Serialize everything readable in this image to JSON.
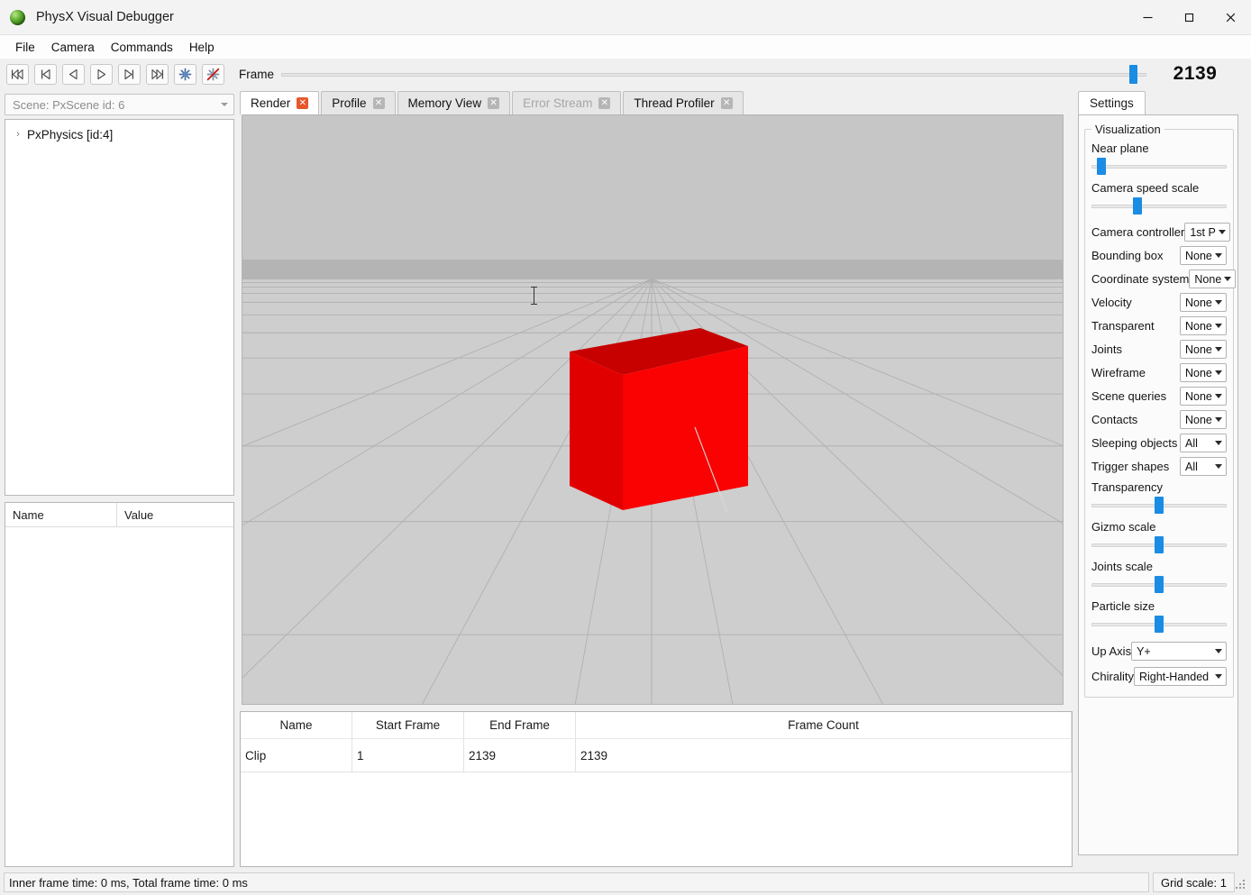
{
  "window": {
    "title": "PhysX Visual Debugger",
    "icon": "sphere-icon",
    "minimize": "—",
    "maximize": "☐",
    "close": "✕"
  },
  "menubar": {
    "items": [
      {
        "label": "File"
      },
      {
        "label": "Camera"
      },
      {
        "label": "Commands"
      },
      {
        "label": "Help"
      }
    ]
  },
  "toolbar": {
    "buttons": [
      {
        "name": "skip-to-start-button",
        "icon": "skip-to-start-icon"
      },
      {
        "name": "step-back-button",
        "icon": "step-back-icon"
      },
      {
        "name": "play-reverse-button",
        "icon": "play-reverse-icon"
      },
      {
        "name": "play-button",
        "icon": "play-icon"
      },
      {
        "name": "step-forward-button",
        "icon": "step-forward-icon"
      },
      {
        "name": "skip-to-end-button",
        "icon": "skip-to-end-icon"
      },
      {
        "name": "connect-button",
        "icon": "asterisk-icon"
      },
      {
        "name": "disconnect-button",
        "icon": "asterisk-disabled-icon"
      }
    ],
    "frame_label": "Frame",
    "frame_value": "2139",
    "frame_slider_percent": 99
  },
  "left": {
    "scene_combo": {
      "value": "Scene: PxScene id: 6",
      "icon": "chevron-down-icon"
    },
    "tree": {
      "items": [
        {
          "label": "PxPhysics [id:4]",
          "expander": "›"
        }
      ]
    },
    "properties": {
      "columns": [
        "Name",
        "Value"
      ],
      "rows": []
    }
  },
  "tabs": [
    {
      "label": "Render",
      "active": true,
      "disabled": false,
      "close": "✕"
    },
    {
      "label": "Profile",
      "active": false,
      "disabled": false,
      "close": "✕"
    },
    {
      "label": "Memory View",
      "active": false,
      "disabled": false,
      "close": "✕"
    },
    {
      "label": "Error Stream",
      "active": false,
      "disabled": true,
      "close": "✕"
    },
    {
      "label": "Thread Profiler",
      "active": false,
      "disabled": false,
      "close": "✕"
    }
  ],
  "viewport": {
    "name": "render-viewport",
    "sky_color": "#c6c6c6",
    "horizon_color": "#b4b4b4",
    "ground_color": "#cecece",
    "grid_color": "#b0b0b0",
    "cube_front_color": "#fa0202",
    "cube_top_color": "#c70000",
    "cube_side_color": "#e60000",
    "cursor": "i-beam"
  },
  "clip_table": {
    "columns": [
      "Name",
      "Start Frame",
      "End Frame",
      "Frame Count"
    ],
    "rows": [
      {
        "name": "Clip",
        "start_frame": "1",
        "end_frame": "2139",
        "frame_count": "2139"
      }
    ]
  },
  "settings": {
    "tab_label": "Settings",
    "group_title": "Visualization",
    "sliders": [
      {
        "label": "Near plane",
        "percent": 4
      },
      {
        "label": "Camera speed scale",
        "percent": 33
      },
      {
        "label": "Transparency",
        "percent": 50
      },
      {
        "label": "Gizmo scale",
        "percent": 50
      },
      {
        "label": "Joints scale",
        "percent": 50
      },
      {
        "label": "Particle size",
        "percent": 50
      }
    ],
    "combos": [
      {
        "label": "Camera controller",
        "value": "1st P",
        "size": "sm"
      },
      {
        "label": "Bounding box",
        "value": "None",
        "size": "sm"
      },
      {
        "label": "Coordinate system",
        "value": "None",
        "size": "sm"
      },
      {
        "label": "Velocity",
        "value": "None",
        "size": "sm"
      },
      {
        "label": "Transparent",
        "value": "None",
        "size": "sm"
      },
      {
        "label": "Joints",
        "value": "None",
        "size": "sm"
      },
      {
        "label": "Wireframe",
        "value": "None",
        "size": "sm"
      },
      {
        "label": "Scene queries",
        "value": "None",
        "size": "sm"
      },
      {
        "label": "Contacts",
        "value": "None",
        "size": "sm"
      },
      {
        "label": "Sleeping objects",
        "value": "All",
        "size": "sm"
      },
      {
        "label": "Trigger shapes",
        "value": "All",
        "size": "sm"
      }
    ],
    "bottom_combos": [
      {
        "label": "Up Axis",
        "value": "Y+"
      },
      {
        "label": "Chirality",
        "value": "Right-Handed"
      }
    ]
  },
  "statusbar": {
    "left_text": "Inner frame time: 0 ms, Total frame time: 0 ms",
    "right_text": "Grid scale: 1"
  },
  "colors": {
    "accent": "#1b8ce3",
    "tab_close_active": "#e8562a",
    "cube_red": "#fa0202"
  }
}
